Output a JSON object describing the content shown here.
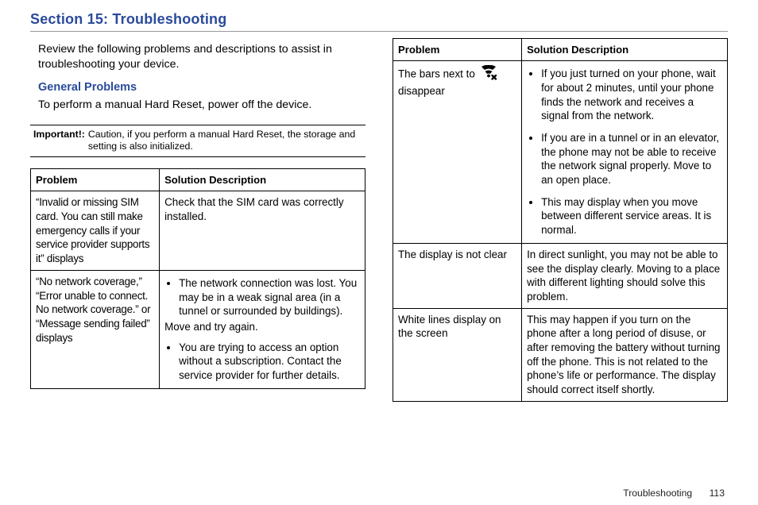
{
  "section_title": "Section 15: Troubleshooting",
  "intro": "Review the following problems and descriptions to assist in troubleshooting your device.",
  "subheading": "General Problems",
  "subintro": "To perform a manual Hard Reset, power off the device.",
  "important_label": "Important!:",
  "important_text": "Caution, if you perform a manual Hard Reset, the storage and setting is also initialized.",
  "table_headers": {
    "problem": "Problem",
    "solution": "Solution Description"
  },
  "left_table": [
    {
      "problem": "“Invalid or missing SIM card. You can still make emergency calls if your service provider supports it” displays",
      "solution_plain": "Check that the SIM card was correctly installed."
    },
    {
      "problem": "“No network coverage,” “Error unable to connect. No network coverage.” or “Message sending failed” displays",
      "solution_bullets_a": [
        "The network connection was lost. You may be in a weak signal area (in a tunnel or surrounded by buildings)."
      ],
      "solution_mid": "Move and try again.",
      "solution_bullets_b": [
        "You are trying to access an option without a subscription. Contact the service provider for further details."
      ]
    }
  ],
  "right_table": [
    {
      "problem_prefix": "The bars next to",
      "problem_suffix": "disappear",
      "has_icon": true,
      "solution_bullets": [
        "If you just turned on your phone, wait for about 2 minutes, until your phone finds the network and receives a signal from the network.",
        "If you are in a tunnel or in an elevator, the phone may not be able to receive the network signal properly. Move to an open place.",
        "This may display when you move between different service areas. It is normal."
      ]
    },
    {
      "problem": "The display is not clear",
      "solution_plain": "In direct sunlight, you may not be able to see the display clearly. Moving to a place with different lighting should solve this problem."
    },
    {
      "problem": "White lines display on the screen",
      "solution_plain": "This may happen if you turn on the phone after a long period of disuse, or after removing the battery without turning off the phone. This is not related to the phone’s life or performance. The display should correct itself shortly."
    }
  ],
  "footer_text": "Troubleshooting",
  "footer_page": "113"
}
